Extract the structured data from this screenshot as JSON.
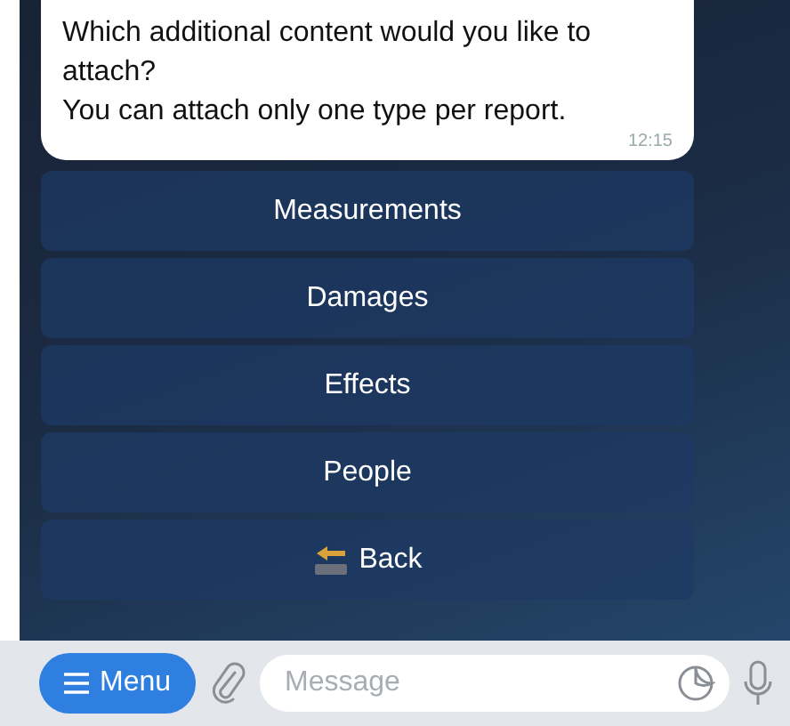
{
  "message": {
    "lines": [
      "Which additional content would you like to attach?",
      "You can attach only one type per report."
    ],
    "time": "12:15"
  },
  "keyboard": [
    {
      "label": "Measurements",
      "kind": "plain"
    },
    {
      "label": "Damages",
      "kind": "plain"
    },
    {
      "label": "Effects",
      "kind": "plain"
    },
    {
      "label": "People",
      "kind": "plain"
    },
    {
      "label": "Back",
      "kind": "back"
    }
  ],
  "input_bar": {
    "menu_label": "Menu",
    "placeholder": "Message"
  }
}
